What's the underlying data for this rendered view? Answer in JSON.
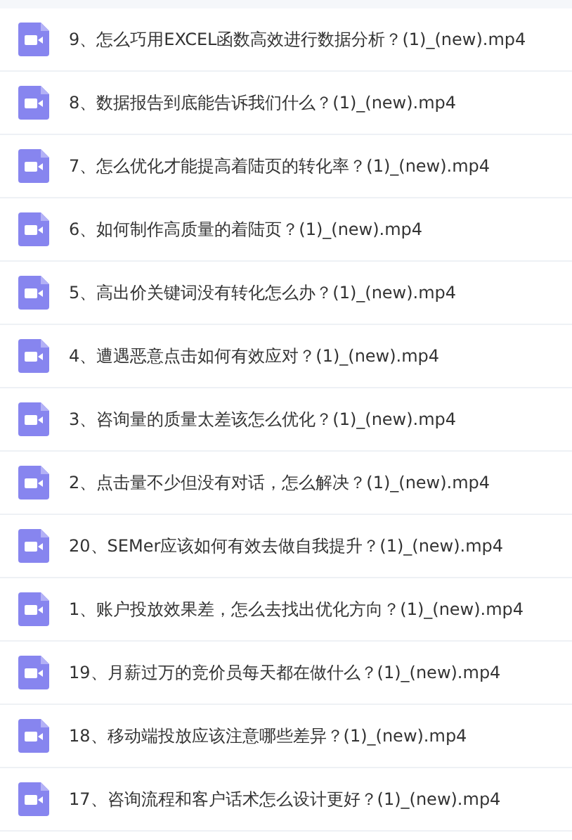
{
  "files": [
    {
      "name": "9、怎么巧用EXCEL函数高效进行数据分析？(1)_(new).mp4",
      "kind": "video"
    },
    {
      "name": "8、数据报告到底能告诉我们什么？(1)_(new).mp4",
      "kind": "video"
    },
    {
      "name": "7、怎么优化才能提高着陆页的转化率？(1)_(new).mp4",
      "kind": "video"
    },
    {
      "name": "6、如何制作高质量的着陆页？(1)_(new).mp4",
      "kind": "video"
    },
    {
      "name": "5、高出价关键词没有转化怎么办？(1)_(new).mp4",
      "kind": "video"
    },
    {
      "name": "4、遭遇恶意点击如何有效应对？(1)_(new).mp4",
      "kind": "video"
    },
    {
      "name": "3、咨询量的质量太差该怎么优化？(1)_(new).mp4",
      "kind": "video"
    },
    {
      "name": "2、点击量不少但没有对话，怎么解决？(1)_(new).mp4",
      "kind": "video"
    },
    {
      "name": "20、SEMer应该如何有效去做自我提升？(1)_(new).mp4",
      "kind": "video"
    },
    {
      "name": "1、账户投放效果差，怎么去找出优化方向？(1)_(new).mp4",
      "kind": "video"
    },
    {
      "name": "19、月薪过万的竞价员每天都在做什么？(1)_(new).mp4",
      "kind": "video"
    },
    {
      "name": "18、移动端投放应该注意哪些差异？(1)_(new).mp4",
      "kind": "video"
    },
    {
      "name": "17、咨询流程和客户话术怎么设计更好？(1)_(new).mp4",
      "kind": "video"
    }
  ]
}
